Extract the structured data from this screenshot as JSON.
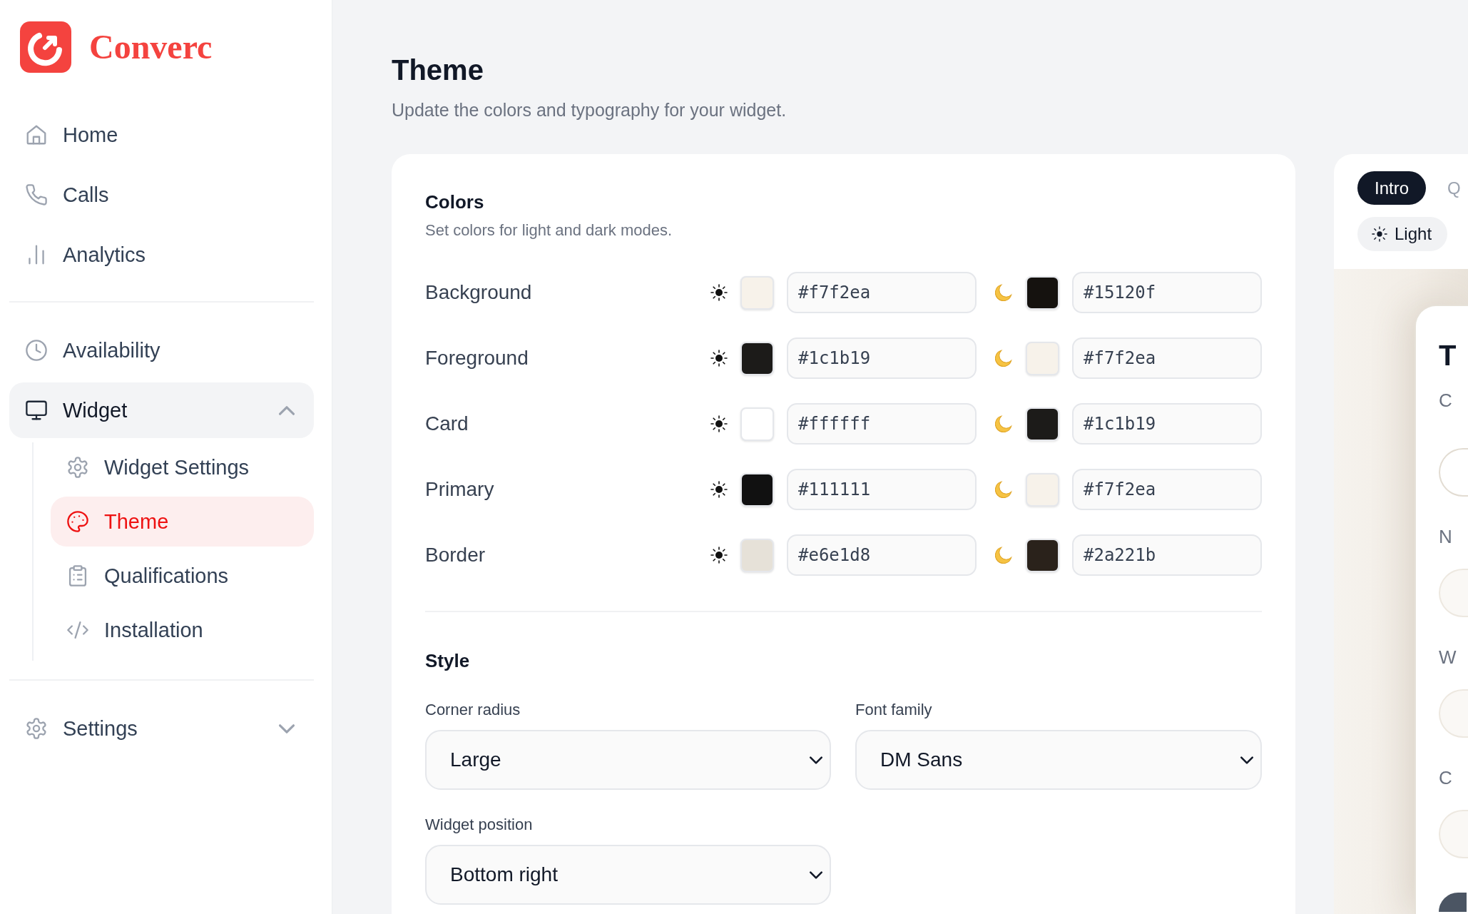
{
  "sidebar": {
    "logo": {
      "text": "Converc"
    },
    "groups": [
      {
        "items": [
          {
            "label": "Home",
            "kind": "link",
            "selected": false
          },
          {
            "label": "Calls",
            "kind": "link",
            "selected": false
          },
          {
            "label": "Analytics",
            "kind": "link",
            "selected": false
          }
        ]
      },
      {
        "items": [
          {
            "label": "Availability",
            "kind": "link",
            "selected": false
          },
          {
            "label": "Widget",
            "kind": "group",
            "selected": false,
            "expanded": true,
            "children": [
              {
                "label": "Widget Settings",
                "selected": false
              },
              {
                "label": "Theme",
                "selected": true
              },
              {
                "label": "Qualifications",
                "selected": false
              },
              {
                "label": "Installation",
                "selected": false
              }
            ]
          }
        ]
      },
      {
        "items": [
          {
            "label": "Settings",
            "kind": "group",
            "selected": false,
            "expanded": false
          }
        ]
      }
    ]
  },
  "header": {
    "title": "Theme",
    "subtitle": "Update the colors and typography for your widget."
  },
  "colors": {
    "title": "Colors",
    "subtitle": "Set colors for light and dark modes.",
    "rows": [
      {
        "label": "Background",
        "light": "#f7f2ea",
        "dark": "#15120f"
      },
      {
        "label": "Foreground",
        "light": "#1c1b19",
        "dark": "#f7f2ea"
      },
      {
        "label": "Card",
        "light": "#ffffff",
        "dark": "#1c1b19"
      },
      {
        "label": "Primary",
        "light": "#111111",
        "dark": "#f7f2ea"
      },
      {
        "label": "Border",
        "light": "#e6e1d8",
        "dark": "#2a221b"
      }
    ]
  },
  "style": {
    "title": "Style",
    "fields": [
      {
        "label": "Corner radius",
        "value": "Large"
      },
      {
        "label": "Font family",
        "value": "DM Sans"
      },
      {
        "label": "Widget position",
        "value": "Bottom right"
      }
    ]
  },
  "preview": {
    "tabs": [
      {
        "label": "Intro",
        "selected": true
      },
      {
        "label": "Q",
        "selected": false
      }
    ],
    "mode_toggle": {
      "label": "Light"
    },
    "card": {
      "title": "T",
      "subtitle": "C",
      "fields": [
        {
          "kind": "outlined"
        },
        {
          "kind": "filled",
          "label": "N"
        },
        {
          "kind": "filled",
          "label": "W"
        },
        {
          "kind": "filled",
          "label": "C"
        }
      ]
    }
  }
}
